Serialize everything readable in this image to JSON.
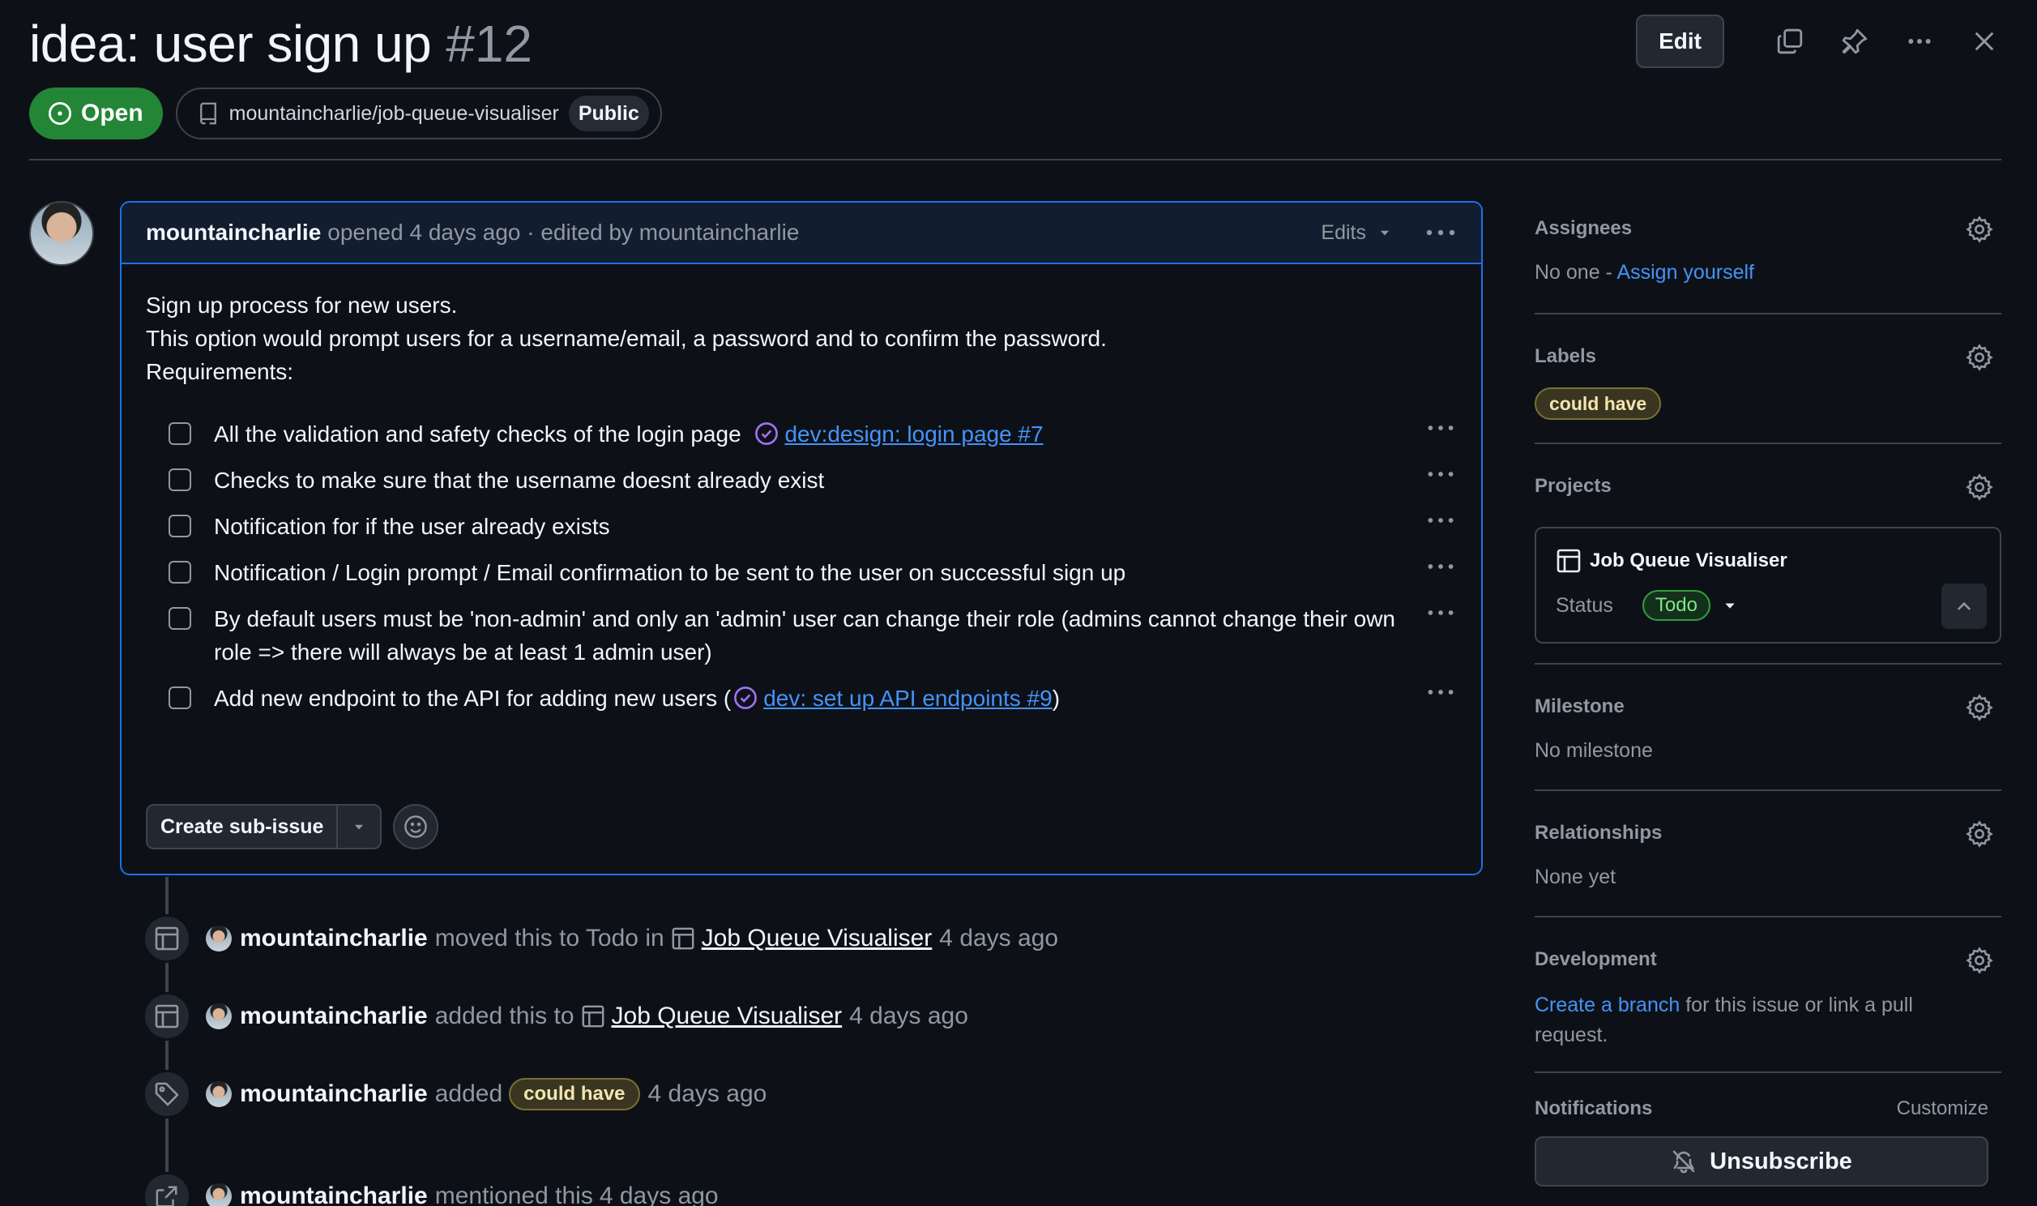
{
  "header": {
    "title": "idea: user sign up",
    "number": "#12",
    "edit_label": "Edit",
    "state": "Open",
    "repo": "mountaincharlie/job-queue-visualiser",
    "visibility": "Public"
  },
  "comment": {
    "author": "mountaincharlie",
    "meta": "opened 4 days ago · edited by mountaincharlie",
    "edits_label": "Edits",
    "intro": "Sign up process for new users.",
    "intro2": "This option would prompt users for a username/email, a password and to confirm the password.",
    "requirements": "Requirements:",
    "tasks": [
      {
        "text": "All the validation and safety checks of the login page",
        "link": "dev:design: login page #7"
      },
      {
        "text": "Checks to make sure that the username doesnt already exist"
      },
      {
        "text": "Notification for if the user already exists"
      },
      {
        "text": "Notification / Login prompt / Email confirmation to be sent to the user on successful sign up"
      },
      {
        "text": "By default users must be 'non-admin' and only an 'admin' user can change their role (admins cannot change their own role => there will always be at least 1 admin user)"
      },
      {
        "text": "Add new endpoint to the API for adding new users (",
        "link": "dev: set up API endpoints #9",
        "suffix": ")"
      }
    ],
    "create_subissue_label": "Create sub-issue"
  },
  "timeline": [
    {
      "actor": "mountaincharlie",
      "action": "moved this to Todo in",
      "project": "Job Queue Visualiser",
      "time": "4 days ago"
    },
    {
      "actor": "mountaincharlie",
      "action": "added this to",
      "project": "Job Queue Visualiser",
      "time": "4 days ago"
    },
    {
      "actor": "mountaincharlie",
      "action": "added",
      "label": "could have",
      "time": "4 days ago"
    },
    {
      "actor": "mountaincharlie",
      "action": "mentioned this",
      "time": "4 days ago"
    }
  ],
  "sidebar": {
    "assignees": {
      "title": "Assignees",
      "value": "No one - ",
      "link": "Assign yourself"
    },
    "labels": {
      "title": "Labels",
      "value": "could have"
    },
    "projects": {
      "title": "Projects",
      "name": "Job Queue Visualiser",
      "status_label": "Status",
      "status_value": "Todo"
    },
    "milestone": {
      "title": "Milestone",
      "value": "No milestone"
    },
    "relationships": {
      "title": "Relationships",
      "value": "None yet"
    },
    "development": {
      "title": "Development",
      "link": "Create a branch",
      "value": " for this issue or link a pull request."
    },
    "notifications": {
      "title": "Notifications",
      "customize": "Customize",
      "unsubscribe": "Unsubscribe"
    }
  },
  "colors": {
    "accent": "#1f6feb",
    "link": "#4493f8",
    "open": "#238636",
    "background": "#0d1117"
  }
}
